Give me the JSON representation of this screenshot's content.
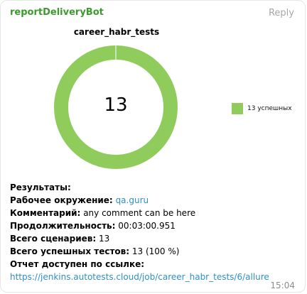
{
  "message": {
    "sender": "reportDeliveryBot",
    "reply_label": "Reply",
    "time": "15:04"
  },
  "chart_data": {
    "type": "pie",
    "title": "career_habr_tests",
    "center_value": "13",
    "slices": [
      {
        "name": "13 успешных",
        "value": 13,
        "color": "#8fcc5c"
      }
    ],
    "legend_position": "right"
  },
  "report": {
    "results_label": "Результаты:",
    "env_label": "Рабочее окружение:",
    "env_value": "qa.guru",
    "comment_label": "Комментарий:",
    "comment_value": "any comment can be here",
    "duration_label": "Продолжительность:",
    "duration_value": "00:03:00.951",
    "total_label": "Всего сценариев:",
    "total_value": "13",
    "passed_label": "Всего успешных тестов:",
    "passed_value": "13 (100 %)",
    "report_label": "Отчет доступен по ссылке:",
    "report_url": "https://jenkins.autotests.cloud/job/career_habr_tests/6/allure"
  },
  "colors": {
    "sender": "#3a9b2c",
    "link": "#2f8fc7",
    "donut": "#8fcc5c"
  }
}
